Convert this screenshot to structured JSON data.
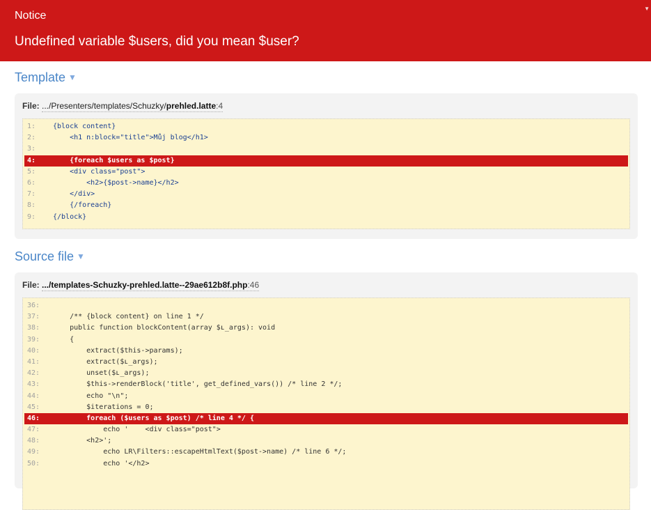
{
  "error": {
    "type": "Notice",
    "message": "Undefined variable $users, did you mean $user?"
  },
  "template": {
    "title": "Template",
    "file_label": "File:",
    "file_dir": ".../Presenters/templates/Schuzky/",
    "file_name": "prehled.latte",
    "file_line": ":4",
    "highlight": 4,
    "lines": [
      {
        "no": "1:",
        "text": "{block content}"
      },
      {
        "no": "2:",
        "text": "    <h1 n:block=\"title\">Můj blog</h1>"
      },
      {
        "no": "3:",
        "text": ""
      },
      {
        "no": "4:",
        "text": "    {foreach $users as $post}"
      },
      {
        "no": "5:",
        "text": "    <div class=\"post\">"
      },
      {
        "no": "6:",
        "text": "        <h2>{$post->name}</h2>"
      },
      {
        "no": "7:",
        "text": "    </div>"
      },
      {
        "no": "8:",
        "text": "    {/foreach}"
      },
      {
        "no": "9:",
        "text": "{/block}"
      }
    ]
  },
  "source": {
    "title": "Source file",
    "file_label": "File:",
    "file_dir": ".../templates-Schuzky-prehled.latte--29ae612b8f.php",
    "file_line": ":46",
    "lines": [
      {
        "no": "36:",
        "text": ""
      },
      {
        "no": "37:",
        "text": "    /** {block content} on line 1 */"
      },
      {
        "no": "38:",
        "text": "    public function blockContent(array $ʟ_args): void"
      },
      {
        "no": "39:",
        "text": "    {"
      },
      {
        "no": "40:",
        "text": "        extract($this->params);"
      },
      {
        "no": "41:",
        "text": "        extract($ʟ_args);"
      },
      {
        "no": "42:",
        "text": "        unset($ʟ_args);"
      },
      {
        "no": "43:",
        "text": "        $this->renderBlock('title', get_defined_vars()) /* line 2 */;"
      },
      {
        "no": "44:",
        "text": "        echo \"\\n\";"
      },
      {
        "no": "45:",
        "text": "        $iterations = 0;"
      },
      {
        "no": "46:",
        "text": "        foreach ($users as $post) /* line 4 */ {"
      },
      {
        "no": "47:",
        "text": "            echo '    <div class=\"post\">"
      },
      {
        "no": "48:",
        "text": "        <h2>';"
      },
      {
        "no": "49:",
        "text": "            echo LR\\Filters::escapeHtmlText($post->name) /* line 6 */;"
      },
      {
        "no": "50:",
        "text": "            echo '</h2>"
      }
    ]
  },
  "colors": {
    "header_red": "#cd1818",
    "link_blue": "#4a86c8",
    "code_bg": "#fdf5ce"
  },
  "icons": {
    "section_toggle": "triangle-down-icon",
    "panel_toggle": "triangle-down-icon"
  }
}
